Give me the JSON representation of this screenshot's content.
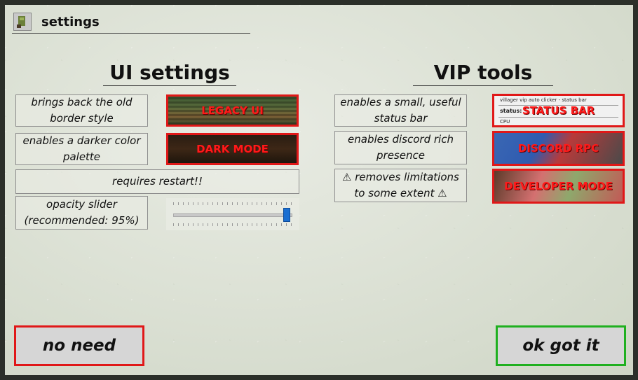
{
  "window": {
    "title": "settings"
  },
  "ui_settings": {
    "heading": "UI settings",
    "legacy": {
      "description": "brings back the old border style",
      "button": "LEGACY UI"
    },
    "dark": {
      "description": "enables a darker color palette",
      "button": "DARK MODE"
    },
    "restart_note": "requires restart!!",
    "opacity": {
      "description": "opacity slider (recommended: 95%)",
      "value_fraction": 0.95
    }
  },
  "vip_tools": {
    "heading": "VIP tools",
    "status_bar": {
      "description": "enables a small, useful status bar",
      "button": "STATUS BAR",
      "preview_title": "villager vip auto clicker - status bar",
      "preview_status": "status:",
      "preview_cpu": "CPU"
    },
    "discord": {
      "description": "enables discord rich presence",
      "button": "DISCORD RPC"
    },
    "developer": {
      "description": "⚠ removes limitations to some extent ⚠",
      "button": "DEVELOPER MODE"
    }
  },
  "buttons": {
    "no_need": "no need",
    "ok": "ok got it"
  },
  "colors": {
    "danger": "#e01818",
    "success": "#1fb01f",
    "accent": "#1b6fd1"
  }
}
